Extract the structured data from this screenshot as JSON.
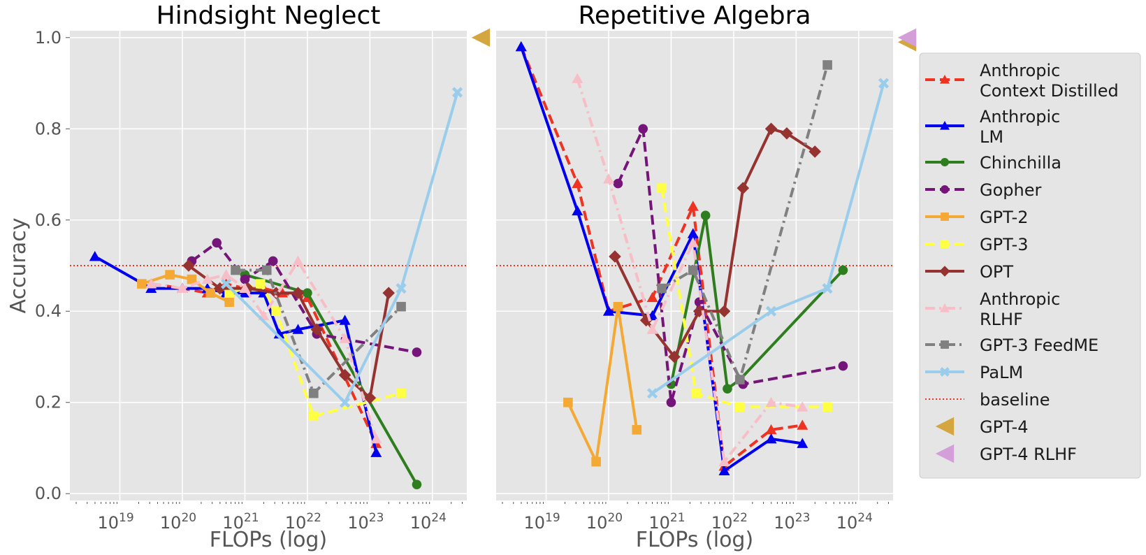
{
  "chart_data": [
    {
      "type": "line",
      "title": "Hindsight Neglect",
      "xlabel": "FLOPs (log)",
      "ylabel": "Accuracy",
      "xscale": "log",
      "xlim_exp": [
        18.2,
        24.55
      ],
      "ylim": [
        -0.015,
        1.015
      ],
      "x_ticks": [
        {
          "exp": 19,
          "label": "10",
          "sup": "19"
        },
        {
          "exp": 20,
          "label": "10",
          "sup": "20"
        },
        {
          "exp": 21,
          "label": "10",
          "sup": "21"
        },
        {
          "exp": 22,
          "label": "10",
          "sup": "22"
        },
        {
          "exp": 23,
          "label": "10",
          "sup": "23"
        },
        {
          "exp": 24,
          "label": "10",
          "sup": "24"
        }
      ],
      "y_ticks": [
        "0.0",
        "0.2",
        "0.4",
        "0.6",
        "0.8",
        "1.0"
      ],
      "grid": true,
      "baseline": 0.5,
      "gpt4": {
        "GPT-4": 1.0
      },
      "series": [
        {
          "name": "Anthropic Context Distilled",
          "x_exp": [
            19.5,
            20.0,
            20.4,
            20.7,
            21.0,
            21.3,
            21.6,
            22.0,
            23.1
          ],
          "y": [
            0.46,
            0.45,
            0.44,
            0.46,
            0.45,
            0.45,
            0.44,
            0.43,
            0.11
          ]
        },
        {
          "name": "Anthropic LM",
          "x_exp": [
            18.6,
            19.5,
            20.0,
            20.4,
            20.7,
            21.0,
            21.3,
            21.55,
            21.85,
            22.6,
            23.1
          ],
          "y": [
            0.52,
            0.45,
            0.45,
            0.45,
            0.44,
            0.44,
            0.44,
            0.35,
            0.36,
            0.38,
            0.09
          ]
        },
        {
          "name": "Chinchilla",
          "x_exp": [
            21.0,
            22.0,
            23.75
          ],
          "y": [
            0.48,
            0.44,
            0.02
          ]
        },
        {
          "name": "Gopher",
          "x_exp": [
            20.15,
            20.55,
            21.0,
            21.45,
            22.15,
            23.75
          ],
          "y": [
            0.51,
            0.55,
            0.47,
            0.51,
            0.35,
            0.31
          ]
        },
        {
          "name": "GPT-2",
          "x_exp": [
            19.35,
            19.8,
            20.15,
            20.45,
            20.75
          ],
          "y": [
            0.46,
            0.48,
            0.47,
            0.44,
            0.42
          ]
        },
        {
          "name": "GPT-3",
          "x_exp": [
            20.75,
            21.25,
            21.5,
            22.1,
            23.5
          ],
          "y": [
            0.44,
            0.46,
            0.4,
            0.17,
            0.22
          ]
        },
        {
          "name": "OPT",
          "x_exp": [
            20.1,
            20.6,
            21.05,
            21.5,
            21.85,
            22.15,
            22.6,
            23.0,
            23.3
          ],
          "y": [
            0.5,
            0.45,
            0.45,
            0.44,
            0.44,
            0.36,
            0.26,
            0.21,
            0.44
          ]
        },
        {
          "name": "Anthropic RLHF",
          "x_exp": [
            19.5,
            20.0,
            20.4,
            20.7,
            21.0,
            21.3,
            21.85,
            22.6,
            23.1
          ],
          "y": [
            0.46,
            0.45,
            0.47,
            0.48,
            0.45,
            0.39,
            0.51,
            0.34,
            0.12
          ]
        },
        {
          "name": "GPT-3 FeedME",
          "x_exp": [
            20.85,
            21.35,
            22.1,
            23.5
          ],
          "y": [
            0.49,
            0.49,
            0.22,
            0.41
          ]
        },
        {
          "name": "PaLM",
          "x_exp": [
            20.7,
            22.6,
            23.5,
            24.4
          ],
          "y": [
            0.46,
            0.2,
            0.45,
            0.88
          ]
        }
      ]
    },
    {
      "type": "line",
      "title": "Repetitive Algebra",
      "xlabel": "FLOPs (log)",
      "ylabel": "",
      "xscale": "log",
      "xlim_exp": [
        18.2,
        24.55
      ],
      "ylim": [
        -0.015,
        1.015
      ],
      "x_ticks": [
        {
          "exp": 19,
          "label": "10",
          "sup": "19"
        },
        {
          "exp": 20,
          "label": "10",
          "sup": "20"
        },
        {
          "exp": 21,
          "label": "10",
          "sup": "21"
        },
        {
          "exp": 22,
          "label": "10",
          "sup": "22"
        },
        {
          "exp": 23,
          "label": "10",
          "sup": "23"
        },
        {
          "exp": 24,
          "label": "10",
          "sup": "24"
        }
      ],
      "grid": true,
      "baseline": 0.5,
      "gpt4": {
        "GPT-4": 0.99,
        "GPT-4 RLHF": 1.0
      },
      "series": [
        {
          "name": "Anthropic Context Distilled",
          "x_exp": [
            18.6,
            19.5,
            20.0,
            20.7,
            21.35,
            21.85,
            22.6,
            23.1
          ],
          "y": [
            0.98,
            0.68,
            0.4,
            0.43,
            0.63,
            0.06,
            0.14,
            0.15
          ]
        },
        {
          "name": "Anthropic LM",
          "x_exp": [
            18.6,
            19.5,
            20.0,
            20.7,
            21.35,
            21.85,
            22.6,
            23.1
          ],
          "y": [
            0.98,
            0.62,
            0.4,
            0.39,
            0.57,
            0.05,
            0.12,
            0.11
          ]
        },
        {
          "name": "Chinchilla",
          "x_exp": [
            21.0,
            21.55,
            21.9,
            22.1,
            23.75
          ],
          "y": [
            0.24,
            0.61,
            0.23,
            0.25,
            0.49
          ]
        },
        {
          "name": "Gopher",
          "x_exp": [
            20.15,
            20.55,
            21.0,
            21.45,
            22.15,
            23.75
          ],
          "y": [
            0.68,
            0.8,
            0.2,
            0.42,
            0.24,
            0.28
          ]
        },
        {
          "name": "GPT-2",
          "x_exp": [
            19.35,
            19.8,
            20.15,
            20.45
          ],
          "y": [
            0.2,
            0.07,
            0.41,
            0.14
          ]
        },
        {
          "name": "GPT-3",
          "x_exp": [
            20.85,
            21.4,
            22.1,
            23.5
          ],
          "y": [
            0.67,
            0.22,
            0.19,
            0.19
          ]
        },
        {
          "name": "OPT",
          "x_exp": [
            20.1,
            20.6,
            21.05,
            21.45,
            21.85,
            22.15,
            22.6,
            22.85,
            23.3
          ],
          "y": [
            0.52,
            0.38,
            0.3,
            0.4,
            0.4,
            0.67,
            0.8,
            0.79,
            0.75
          ]
        },
        {
          "name": "Anthropic RLHF",
          "x_exp": [
            19.5,
            20.0,
            20.7,
            21.35,
            21.85,
            22.6,
            23.1
          ],
          "y": [
            0.91,
            0.69,
            0.36,
            0.55,
            0.07,
            0.2,
            0.19
          ]
        },
        {
          "name": "GPT-3 FeedME",
          "x_exp": [
            20.85,
            21.35,
            22.1,
            23.5
          ],
          "y": [
            0.45,
            0.49,
            0.25,
            0.94
          ]
        },
        {
          "name": "PaLM",
          "x_exp": [
            20.7,
            22.6,
            23.5,
            24.4
          ],
          "y": [
            0.22,
            0.4,
            0.45,
            0.9
          ]
        }
      ]
    }
  ],
  "legend": {
    "placement": "right",
    "items": [
      {
        "lines": [
          "Anthropic",
          "Context Distilled"
        ],
        "color": "#ee3322",
        "dash": "dashed",
        "marker": "triangle"
      },
      {
        "lines": [
          "Anthropic",
          "LM"
        ],
        "color": "#0000ee",
        "dash": "solid",
        "marker": "triangle"
      },
      {
        "lines": [
          "Chinchilla"
        ],
        "color": "#2e7d1e",
        "dash": "solid",
        "marker": "circle"
      },
      {
        "lines": [
          "Gopher"
        ],
        "color": "#751579",
        "dash": "dashed",
        "marker": "circle"
      },
      {
        "lines": [
          "GPT-2"
        ],
        "color": "#f4a935",
        "dash": "solid",
        "marker": "square"
      },
      {
        "lines": [
          "GPT-3"
        ],
        "color": "#ffff44",
        "dash": "dashed",
        "marker": "square"
      },
      {
        "lines": [
          "OPT"
        ],
        "color": "#963230",
        "dash": "solid",
        "marker": "diamond"
      },
      {
        "lines": [
          "Anthropic",
          "RLHF"
        ],
        "color": "#f7bec8",
        "dash": "dashdot",
        "marker": "triangle"
      },
      {
        "lines": [
          "GPT-3 FeedME"
        ],
        "color": "#808080",
        "dash": "dashdot",
        "marker": "square"
      },
      {
        "lines": [
          "PaLM"
        ],
        "color": "#99cdeb",
        "dash": "solid",
        "marker": "x"
      },
      {
        "lines": [
          "baseline"
        ],
        "color": "#ee3322",
        "dash": "dotted",
        "marker": "none"
      },
      {
        "lines": [
          "GPT-4"
        ],
        "color": "#d4a640",
        "dash": "none",
        "marker": "left-triangle"
      },
      {
        "lines": [
          "GPT-4 RLHF"
        ],
        "color": "#d49ed8",
        "dash": "none",
        "marker": "left-triangle"
      }
    ]
  }
}
